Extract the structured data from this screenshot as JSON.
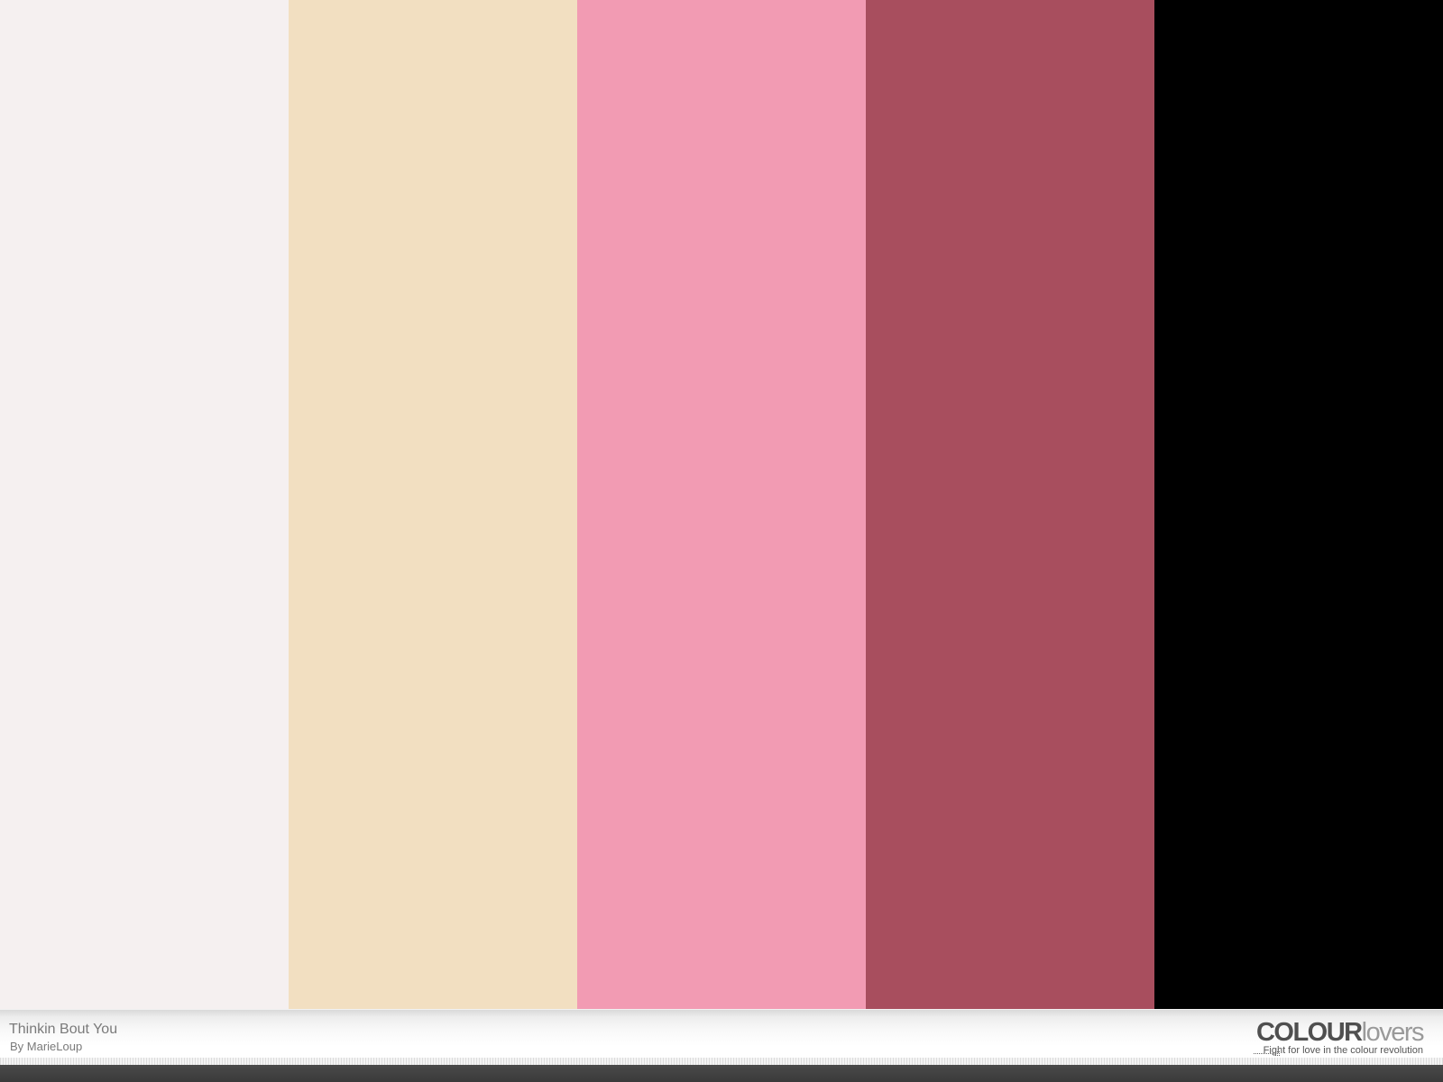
{
  "palette": {
    "title": "Thinkin Bout You",
    "author": "By MarieLoup",
    "swatches": [
      {
        "color": "#F5F0F0"
      },
      {
        "color": "#F2DFC1"
      },
      {
        "color": "#F29BB3"
      },
      {
        "color": "#A84E5E"
      },
      {
        "color": "#000000"
      }
    ]
  },
  "logo": {
    "strong": "COLOUR",
    "light": "lovers",
    "tagline": "Fight for love in the colour revolution"
  }
}
